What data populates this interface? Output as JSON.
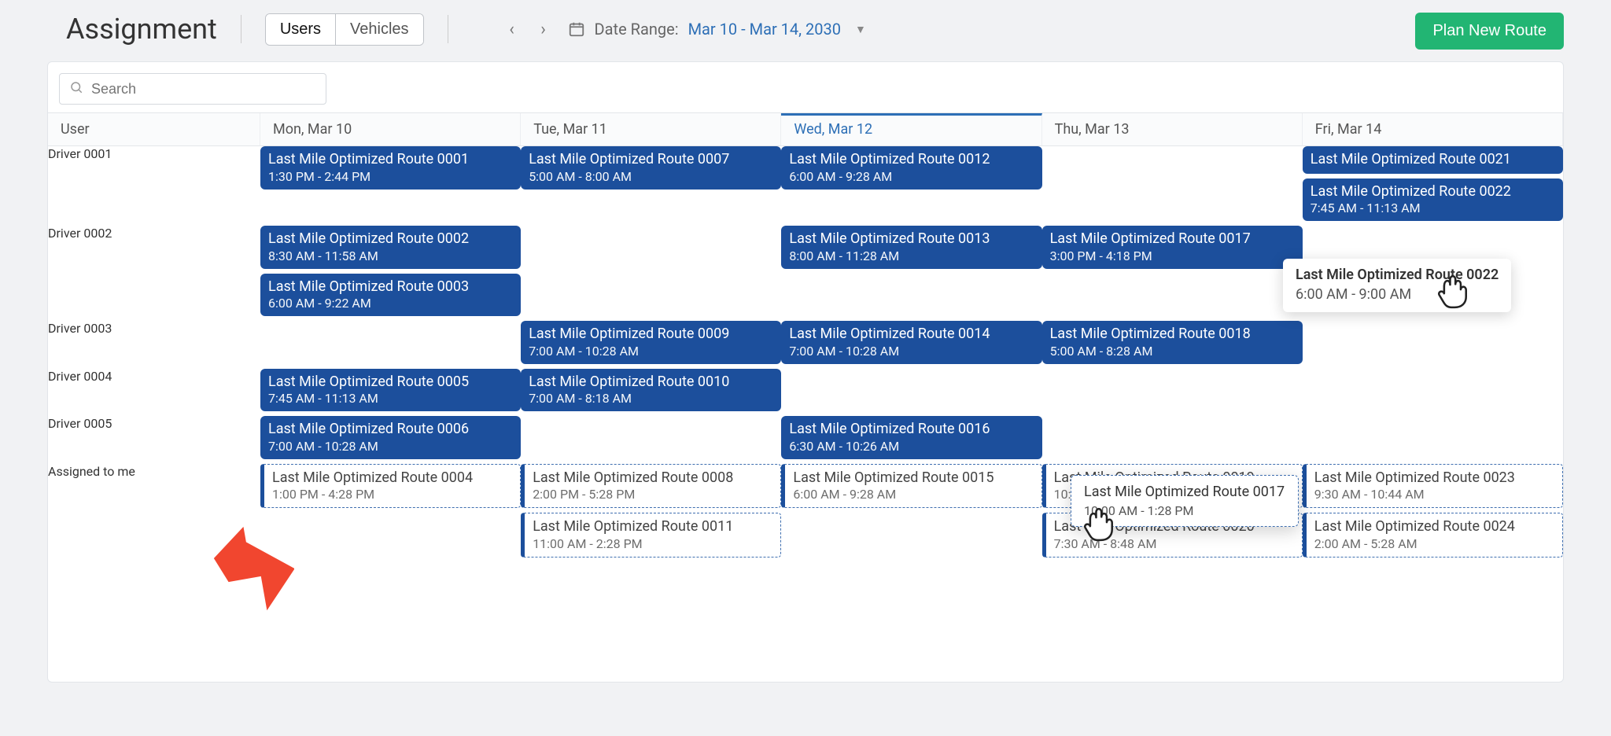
{
  "header": {
    "title": "Assignment",
    "tabs": {
      "users": "Users",
      "vehicles": "Vehicles"
    },
    "date_label": "Date Range:",
    "date_value": "Mar 10 - Mar 14, 2030",
    "plan_button": "Plan New Route"
  },
  "search": {
    "placeholder": "Search"
  },
  "columns": {
    "user": "User",
    "days": [
      "Mon, Mar 10",
      "Tue, Mar 11",
      "Wed, Mar 12",
      "Thu, Mar 13",
      "Fri, Mar 14"
    ],
    "selected_index": 2
  },
  "rows": [
    {
      "user": "Driver 0001",
      "cells": [
        [
          {
            "t": "Last Mile Optimized Route 0001",
            "s": "1:30 PM - 2:44 PM"
          }
        ],
        [
          {
            "t": "Last Mile Optimized Route 0007",
            "s": "5:00 AM - 8:00 AM"
          }
        ],
        [
          {
            "t": "Last Mile Optimized Route 0012",
            "s": "6:00 AM - 9:28 AM"
          }
        ],
        [],
        [
          {
            "t": "Last Mile Optimized Route 0021",
            "s": ""
          },
          {
            "t": "Last Mile Optimized Route 0022",
            "s": "7:45 AM - 11:13 AM"
          }
        ]
      ]
    },
    {
      "user": "Driver 0002",
      "cells": [
        [
          {
            "t": "Last Mile Optimized Route 0002",
            "s": "8:30 AM - 11:58 AM"
          },
          {
            "t": "Last Mile Optimized Route 0003",
            "s": "6:00 AM - 9:22 AM"
          }
        ],
        [],
        [
          {
            "t": "Last Mile Optimized Route 0013",
            "s": "8:00 AM - 11:28 AM"
          }
        ],
        [
          {
            "t": "Last Mile Optimized Route 0017",
            "s": "3:00 PM - 4:18 PM"
          }
        ],
        []
      ]
    },
    {
      "user": "Driver 0003",
      "cells": [
        [],
        [
          {
            "t": "Last Mile Optimized Route 0009",
            "s": "7:00 AM - 10:28 AM"
          }
        ],
        [
          {
            "t": "Last Mile Optimized Route 0014",
            "s": "7:00 AM - 10:28 AM"
          }
        ],
        [
          {
            "t": "Last Mile Optimized Route 0018",
            "s": "5:00 AM - 8:28 AM"
          }
        ],
        []
      ]
    },
    {
      "user": "Driver 0004",
      "cells": [
        [
          {
            "t": "Last Mile Optimized Route 0005",
            "s": "7:45 AM - 11:13 AM"
          }
        ],
        [
          {
            "t": "Last Mile Optimized Route 0010",
            "s": "7:00 AM - 8:18 AM"
          }
        ],
        [],
        [],
        []
      ]
    },
    {
      "user": "Driver 0005",
      "cells": [
        [
          {
            "t": "Last Mile Optimized Route 0006",
            "s": "7:00 AM - 10:28 AM"
          }
        ],
        [],
        [
          {
            "t": "Last Mile Optimized Route 0016",
            "s": "6:30 AM - 10:26 AM"
          }
        ],
        [],
        []
      ]
    },
    {
      "user": "Assigned to me",
      "dashed": true,
      "cells": [
        [
          {
            "t": "Last Mile Optimized Route 0004",
            "s": "1:00 PM - 4:28 PM"
          }
        ],
        [
          {
            "t": "Last Mile Optimized Route 0008",
            "s": "2:00 PM - 5:28 PM"
          },
          {
            "t": "Last Mile Optimized Route 0011",
            "s": "11:00 AM - 2:28 PM"
          }
        ],
        [
          {
            "t": "Last Mile Optimized Route 0015",
            "s": "6:00 AM - 9:28 AM"
          }
        ],
        [
          {
            "t": "Last Mile Optimized Route 0019",
            "s": "10:00 AM - 1:28 PM"
          },
          {
            "t": "Last Mile Optimized Route 0020",
            "s": "7:30 AM - 8:48 AM"
          }
        ],
        [
          {
            "t": "Last Mile Optimized Route 0023",
            "s": "9:30 AM - 10:44 AM"
          },
          {
            "t": "Last Mile Optimized Route 0024",
            "s": "2:00 AM - 5:28 AM"
          }
        ]
      ]
    }
  ],
  "tooltip": {
    "t": "Last Mile Optimized Route 0022",
    "s": "6:00 AM - 9:00 AM"
  },
  "ghost": {
    "t": "Last Mile Optimized Route 0017",
    "s": "10:00 AM - 1:28 PM"
  }
}
